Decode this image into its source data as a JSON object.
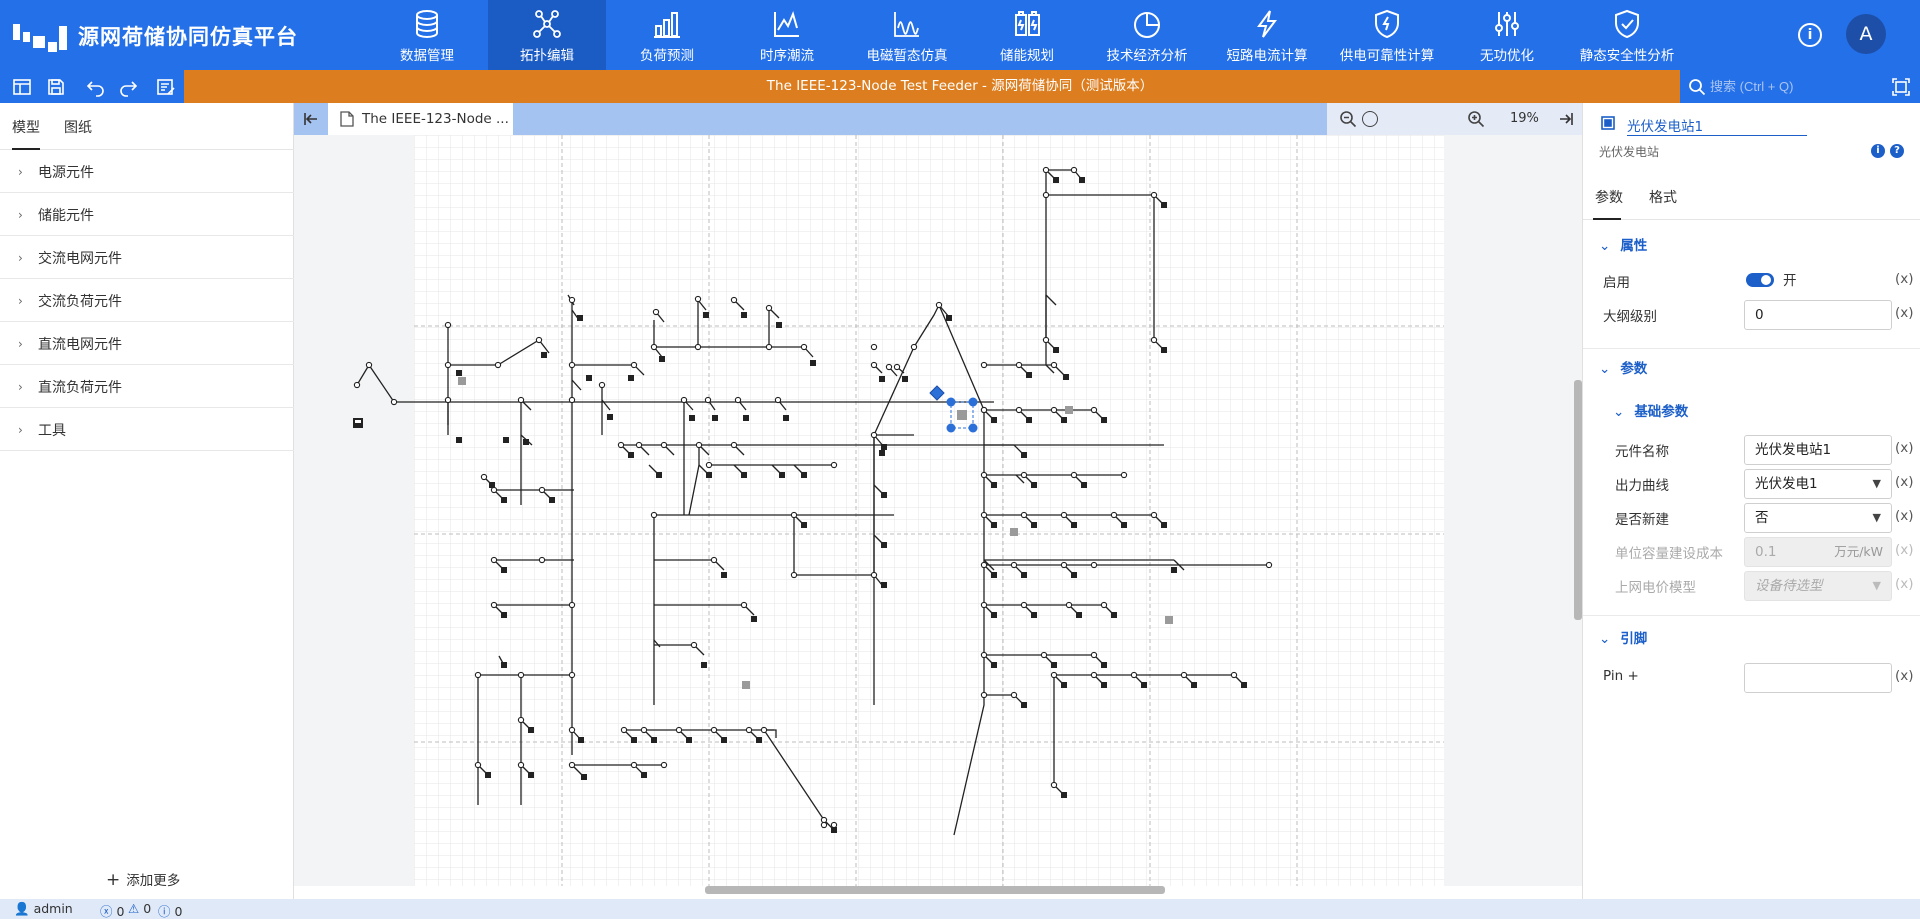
{
  "app": {
    "title": "源网荷储协同仿真平台",
    "user_initial": "A",
    "info_glyph": "i"
  },
  "nav": [
    {
      "label": "数据管理",
      "icon": "database-icon"
    },
    {
      "label": "拓扑编辑",
      "icon": "topology-icon",
      "active": true
    },
    {
      "label": "负荷预测",
      "icon": "bar-chart-icon"
    },
    {
      "label": "时序潮流",
      "icon": "line-chart-icon"
    },
    {
      "label": "电磁暂态仿真",
      "icon": "waveform-icon"
    },
    {
      "label": "储能规划",
      "icon": "battery-icon"
    },
    {
      "label": "技术经济分析",
      "icon": "pie-chart-icon"
    },
    {
      "label": "短路电流计算",
      "icon": "lightning-icon"
    },
    {
      "label": "供电可靠性计算",
      "icon": "shield-bolt-icon"
    },
    {
      "label": "无功优化",
      "icon": "sliders-icon"
    },
    {
      "label": "静态安全性分析",
      "icon": "shield-check-icon"
    }
  ],
  "toolbar": {
    "document_title": "The IEEE-123-Node Test Feeder - 源网荷储协同（测试版本）",
    "search_placeholder": "搜索 (Ctrl + Q)"
  },
  "sidebar": {
    "tabs": [
      "模型",
      "图纸"
    ],
    "categories": [
      "电源元件",
      "储能元件",
      "交流电网元件",
      "交流负荷元件",
      "直流电网元件",
      "直流负荷元件",
      "工具"
    ],
    "add_more": "添加更多"
  },
  "canvas": {
    "tab_label": "The IEEE-123-Node ...",
    "zoom": "19%"
  },
  "panel": {
    "title": "光伏发电站1",
    "subtitle": "光伏发电站",
    "tabs": [
      "参数",
      "格式"
    ],
    "sections": {
      "properties": "属性",
      "params": "参数",
      "basic_params": "基础参数",
      "pins": "引脚"
    },
    "fields": {
      "enabled_label": "启用",
      "enabled_value": "开",
      "outline_label": "大纲级别",
      "outline_value": "0",
      "name_label": "元件名称",
      "name_value": "光伏发电站1",
      "curve_label": "出力曲线",
      "curve_value": "光伏发电1",
      "new_label": "是否新建",
      "new_value": "否",
      "cost_label": "单位容量建设成本",
      "cost_value": "0.1",
      "cost_unit": "万元/kW",
      "price_label": "上网电价模型",
      "price_value": "设备待选型",
      "pin_label": "Pin +",
      "pin_value": "",
      "x_mark": "(x)"
    }
  },
  "status": {
    "user": "admin",
    "errors": "0",
    "warnings": "0",
    "infos": "0"
  }
}
